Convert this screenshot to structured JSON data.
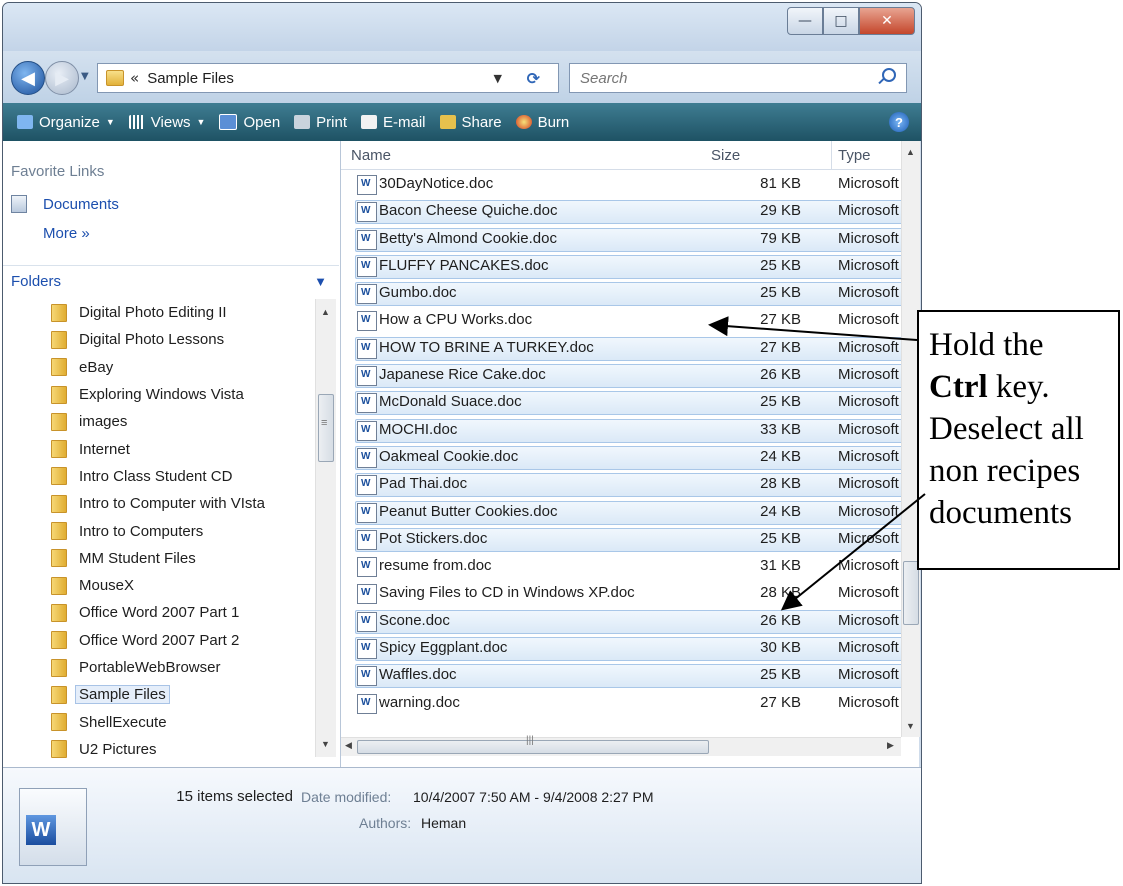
{
  "window": {
    "controls": {
      "minimize": "—",
      "maximize": "□",
      "close": "✕"
    }
  },
  "address": {
    "chevrons": "«",
    "path": "Sample Files"
  },
  "search": {
    "placeholder": "Search"
  },
  "toolbar": {
    "organize": "Organize",
    "views": "Views",
    "open": "Open",
    "print": "Print",
    "email": "E-mail",
    "share": "Share",
    "burn": "Burn",
    "help": "?"
  },
  "nav": {
    "favorite_links_title": "Favorite Links",
    "documents": "Documents",
    "more": "More »",
    "folders_title": "Folders",
    "folders": [
      "Digital Photo Editing II",
      "Digital Photo Lessons",
      "eBay",
      "Exploring Windows Vista",
      "images",
      "Internet",
      "Intro Class Student CD",
      "Intro to Computer with VIsta",
      "Intro to Computers",
      "MM Student Files",
      "MouseX",
      "Office Word 2007 Part 1",
      "Office Word 2007 Part 2",
      "PortableWebBrowser",
      "Sample Files",
      "ShellExecute",
      "U2 Pictures"
    ],
    "selected_folder": "Sample Files"
  },
  "columns": {
    "name": "Name",
    "size": "Size",
    "type": "Type"
  },
  "files": [
    {
      "name": "30DayNotice.doc",
      "size": "81 KB",
      "type": "Microsoft",
      "selected": false
    },
    {
      "name": "Bacon Cheese Quiche.doc",
      "size": "29 KB",
      "type": "Microsoft",
      "selected": true
    },
    {
      "name": "Betty's Almond Cookie.doc",
      "size": "79 KB",
      "type": "Microsoft",
      "selected": true
    },
    {
      "name": "FLUFFY PANCAKES.doc",
      "size": "25 KB",
      "type": "Microsoft",
      "selected": true
    },
    {
      "name": "Gumbo.doc",
      "size": "25 KB",
      "type": "Microsoft",
      "selected": true
    },
    {
      "name": "How a CPU Works.doc",
      "size": "27 KB",
      "type": "Microsoft",
      "selected": false
    },
    {
      "name": "HOW TO BRINE A TURKEY.doc",
      "size": "27 KB",
      "type": "Microsoft",
      "selected": true
    },
    {
      "name": "Japanese Rice Cake.doc",
      "size": "26 KB",
      "type": "Microsoft",
      "selected": true
    },
    {
      "name": "McDonald Suace.doc",
      "size": "25 KB",
      "type": "Microsoft",
      "selected": true
    },
    {
      "name": "MOCHI.doc",
      "size": "33 KB",
      "type": "Microsoft",
      "selected": true
    },
    {
      "name": "Oakmeal Cookie.doc",
      "size": "24 KB",
      "type": "Microsoft",
      "selected": true
    },
    {
      "name": "Pad Thai.doc",
      "size": "28 KB",
      "type": "Microsoft",
      "selected": true
    },
    {
      "name": "Peanut Butter Cookies.doc",
      "size": "24 KB",
      "type": "Microsoft",
      "selected": true
    },
    {
      "name": "Pot Stickers.doc",
      "size": "25 KB",
      "type": "Microsoft",
      "selected": true
    },
    {
      "name": "resume from.doc",
      "size": "31 KB",
      "type": "Microsoft",
      "selected": false
    },
    {
      "name": "Saving Files to CD in Windows XP.doc",
      "size": "28 KB",
      "type": "Microsoft",
      "selected": false
    },
    {
      "name": "Scone.doc",
      "size": "26 KB",
      "type": "Microsoft",
      "selected": true
    },
    {
      "name": "Spicy Eggplant.doc",
      "size": "30 KB",
      "type": "Microsoft",
      "selected": true
    },
    {
      "name": "Waffles.doc",
      "size": "25 KB",
      "type": "Microsoft",
      "selected": true
    },
    {
      "name": "warning.doc",
      "size": "27 KB",
      "type": "Microsoft",
      "selected": false
    }
  ],
  "details": {
    "selection": "15 items selected",
    "date_label": "Date modified:",
    "date_value": "10/4/2007 7:50 AM - 9/4/2008 2:27 PM",
    "authors_label": "Authors:",
    "authors_value": "Heman"
  },
  "callout": {
    "line1": "Hold the",
    "key": "Ctrl",
    "line2_rest": " key.",
    "line3": "Deselect all",
    "line4": "non recipes",
    "line5": "documents"
  },
  "colors": {
    "toolbar": "#1e5264",
    "selection": "#dbe9f7",
    "link": "#1c4fae"
  }
}
